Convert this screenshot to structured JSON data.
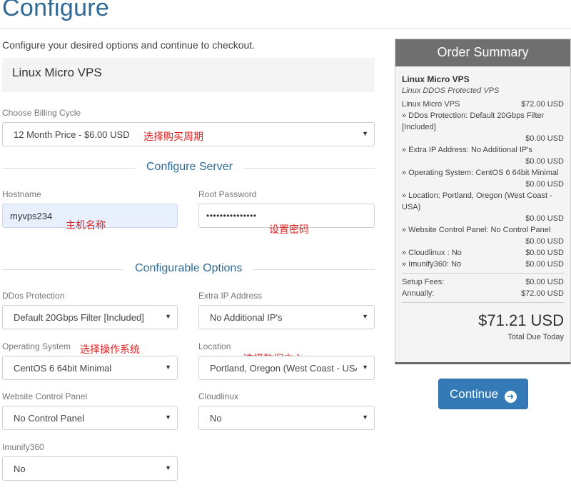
{
  "page": {
    "title": "Configure",
    "intro": "Configure your desired options and continue to checkout."
  },
  "product": {
    "name": "Linux Micro VPS"
  },
  "billing": {
    "label": "Choose Billing Cycle",
    "value": "12 Month Price - $6.00 USD",
    "annotation": "选择购买周期"
  },
  "server": {
    "heading": "Configure Server",
    "hostname_label": "Hostname",
    "hostname_value": "myvps234",
    "hostname_annotation": "主机名称",
    "password_label": "Root Password",
    "password_value": "•••••••••••••••",
    "password_annotation": "设置密码"
  },
  "options": {
    "heading": "Configurable Options",
    "ddos_label": "DDos Protection",
    "ddos_value": "Default 20Gbps Filter [Included]",
    "extra_ip_label": "Extra IP Address",
    "extra_ip_value": "No Additional IP's",
    "os_label": "Operating System",
    "os_value": "CentOS 6 64bit Minimal",
    "os_annotation": "选择操作系统",
    "location_label": "Location",
    "location_value": "Portland, Oregon (West Coast - USA",
    "location_annotation": "选择数据中心",
    "panel_label": "Website Control Panel",
    "panel_value": "No Control Panel",
    "cloudlinux_label": "Cloudlinux",
    "cloudlinux_value": "No",
    "imunify_label": "Imunify360",
    "imunify_value": "No"
  },
  "summary": {
    "title": "Order Summary",
    "product": "Linux Micro VPS",
    "group": "Linux DDOS Protected VPS",
    "base_label": "Linux Micro VPS",
    "base_amount": "$72.00 USD",
    "ddos_line": "» DDos Protection: Default 20Gbps Filter [Included]",
    "ddos_amount": "$0.00 USD",
    "extra_ip_line": "» Extra IP Address: No Additional IP's",
    "extra_ip_amount": "$0.00 USD",
    "os_line": "» Operating System: CentOS 6 64bit Minimal",
    "os_amount": "$0.00 USD",
    "location_line": "» Location: Portland, Oregon (West Coast - USA)",
    "location_amount": "$0.00 USD",
    "panel_line": "» Website Control Panel: No Control Panel",
    "panel_amount": "$0.00 USD",
    "cloudlinux_line": "» Cloudlinux : No",
    "cloudlinux_amount": "$0.00 USD",
    "imunify_line": "» Imunify360: No",
    "imunify_amount": "$0.00 USD",
    "setup_label": "Setup Fees:",
    "setup_amount": "$0.00 USD",
    "annual_label": "Annually:",
    "annual_amount": "$72.00 USD",
    "total": "$71.21 USD",
    "total_label": "Total Due Today"
  },
  "continue_button": {
    "label": "Continue",
    "icon": "arrow-circle-right-icon"
  }
}
